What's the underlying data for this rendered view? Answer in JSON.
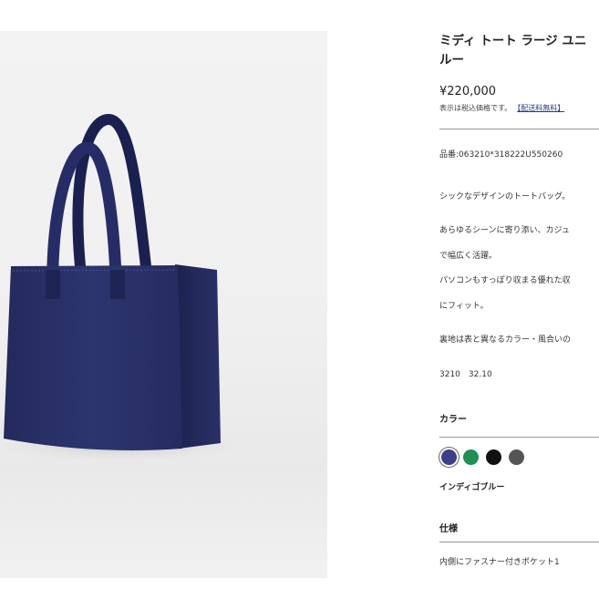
{
  "product": {
    "title_line1": "ミディ トート ラージ ユニ",
    "title_line2": "ルー",
    "price": "¥220,000",
    "tax_note": "表示は税込価格です。",
    "shipping_link": "【配送料無料】",
    "sku": "品番:063210*318222U550260"
  },
  "description": {
    "line1": "シックなデザインのトートバッグ。",
    "line2": "あらゆるシーンに寄り添い、カジュ",
    "line3": "で幅広く活躍。",
    "line4": "パソコンもすっぽり収まる優れた収",
    "line5": "にフィット。",
    "line6": "裏地は表と異なるカラー・風合いの",
    "line7": "3210　32.10"
  },
  "color_section": {
    "heading": "カラー",
    "swatches": [
      {
        "name": "indigo-blue",
        "color": "#3b3f8a",
        "selected": true
      },
      {
        "name": "green",
        "color": "#1f8f55",
        "selected": false
      },
      {
        "name": "black",
        "color": "#111111",
        "selected": false
      },
      {
        "name": "gray",
        "color": "#555555",
        "selected": false
      }
    ],
    "selected_name": "インディゴブルー"
  },
  "spec_section": {
    "heading": "仕様",
    "item1": "内側にファスナー付きポケット1"
  }
}
